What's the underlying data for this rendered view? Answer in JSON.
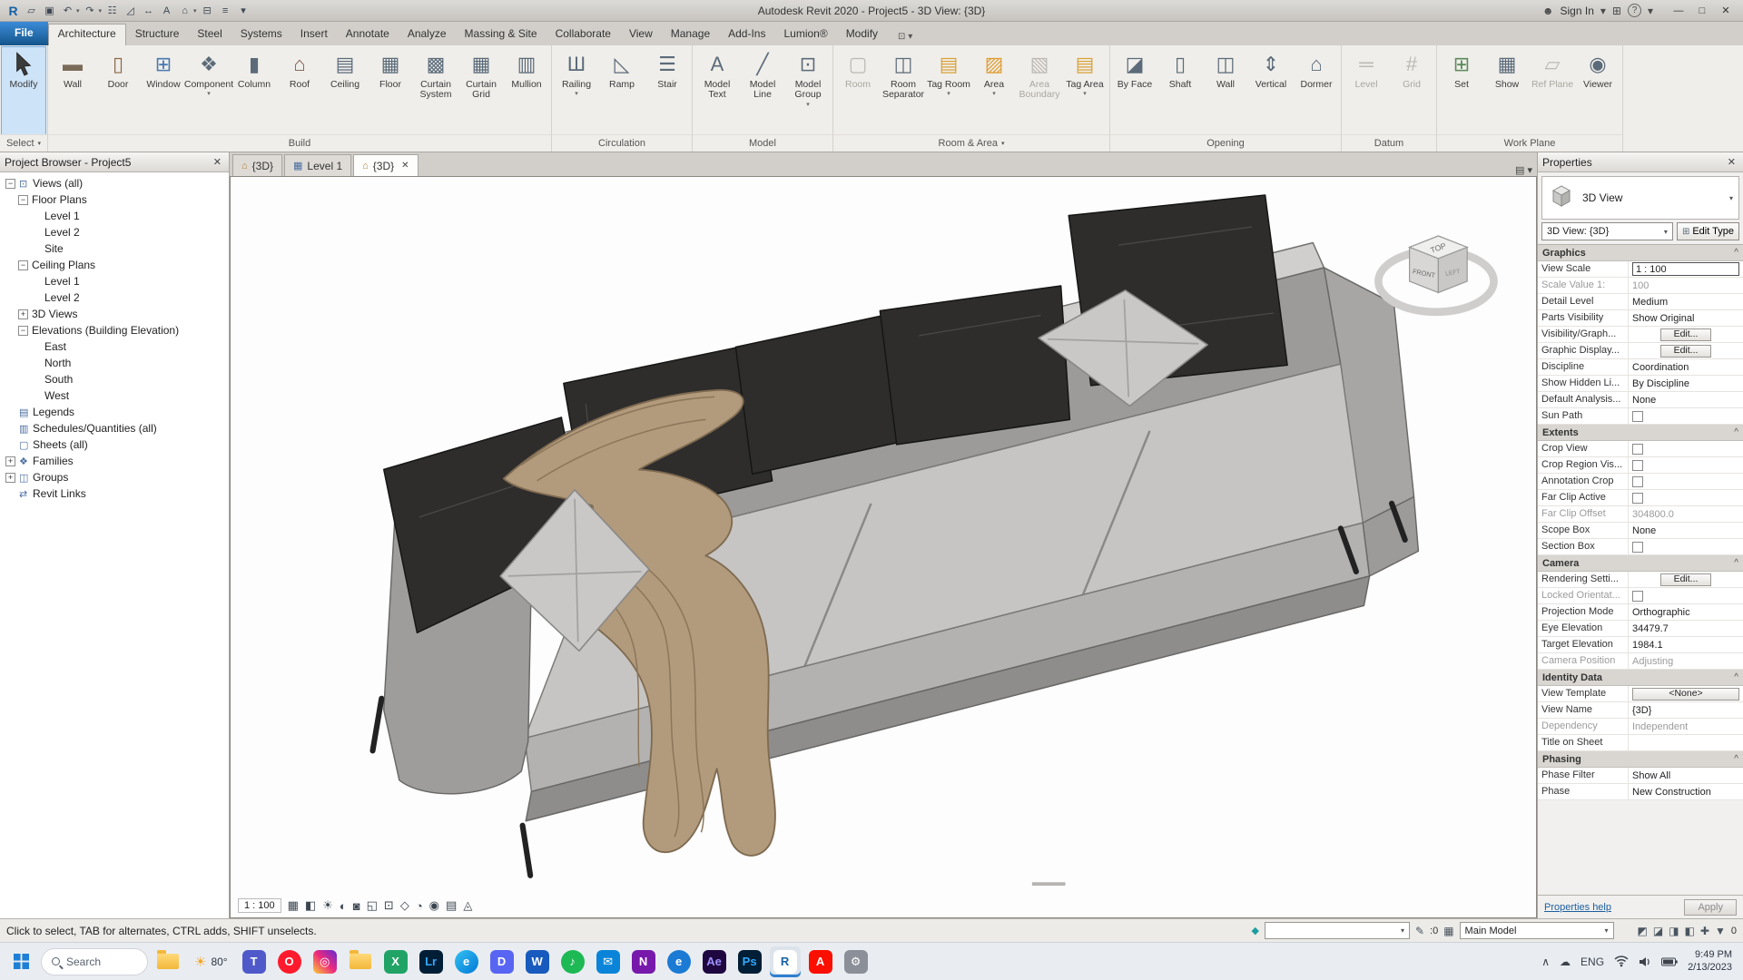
{
  "title_bar": {
    "title": "Autodesk Revit 2020 - Project5 - 3D View: {3D}",
    "qat": [
      {
        "name": "revit-logo",
        "glyph": "R"
      },
      {
        "name": "open-file",
        "glyph": "▱"
      },
      {
        "name": "save",
        "glyph": "▣"
      },
      {
        "name": "undo",
        "glyph": "↶",
        "dropdown": true
      },
      {
        "name": "redo",
        "glyph": "↷",
        "dropdown": true
      },
      {
        "name": "print",
        "glyph": "☷"
      },
      {
        "name": "measure",
        "glyph": "◿"
      },
      {
        "name": "aligned-dimension",
        "glyph": "↔"
      },
      {
        "name": "text-note",
        "glyph": "A"
      },
      {
        "name": "default-3d-view",
        "glyph": "⌂",
        "dropdown": true
      },
      {
        "name": "section",
        "glyph": "⊟"
      },
      {
        "name": "thin-lines",
        "glyph": "≡"
      },
      {
        "name": "customize-qat",
        "glyph": "▾"
      }
    ],
    "right": [
      {
        "name": "user-icon",
        "glyph": "☻"
      },
      {
        "name": "sign-in-label",
        "text": "Sign In"
      },
      {
        "name": "sign-in-caret",
        "glyph": "▾"
      },
      {
        "name": "app-store-icon",
        "glyph": "⊞"
      },
      {
        "name": "help-icon",
        "glyph": "?"
      },
      {
        "name": "help-caret",
        "glyph": "▾"
      }
    ],
    "window_controls": [
      {
        "name": "minimize-button",
        "glyph": "—"
      },
      {
        "name": "maximize-button",
        "glyph": "□"
      },
      {
        "name": "close-button",
        "glyph": "✕"
      }
    ]
  },
  "ribbon": {
    "tabs": [
      {
        "label": "File",
        "file": true
      },
      {
        "label": "Architecture",
        "active": true
      },
      {
        "label": "Structure"
      },
      {
        "label": "Steel"
      },
      {
        "label": "Systems"
      },
      {
        "label": "Insert"
      },
      {
        "label": "Annotate"
      },
      {
        "label": "Analyze"
      },
      {
        "label": "Massing & Site"
      },
      {
        "label": "Collaborate"
      },
      {
        "label": "View"
      },
      {
        "label": "Manage"
      },
      {
        "label": "Add-Ins"
      },
      {
        "label": "Lumion®"
      },
      {
        "label": "Modify"
      }
    ],
    "panels": [
      {
        "label": "Select",
        "dropdown": true,
        "buttons": [
          {
            "label": "Modify",
            "icon": "modify-cursor",
            "glyph": "",
            "big": true,
            "selected": true
          }
        ]
      },
      {
        "label": "Build",
        "buttons": [
          {
            "label": "Wall",
            "icon": "wall",
            "glyph": "▬",
            "color": "#7a6a58"
          },
          {
            "label": "Door",
            "icon": "door",
            "glyph": "▯",
            "color": "#8a6a4a"
          },
          {
            "label": "Window",
            "icon": "window",
            "glyph": "⊞",
            "color": "#4a78b0"
          },
          {
            "label": "Component",
            "icon": "component",
            "glyph": "❖",
            "dropdown": true
          },
          {
            "label": "Column",
            "icon": "column",
            "glyph": "▮"
          },
          {
            "label": "Roof",
            "icon": "roof",
            "glyph": "⌂",
            "color": "#7a5a48"
          },
          {
            "label": "Ceiling",
            "icon": "ceiling",
            "glyph": "▤"
          },
          {
            "label": "Floor",
            "icon": "floor",
            "glyph": "▦"
          },
          {
            "label": "Curtain System",
            "icon": "curtain-system",
            "glyph": "▩"
          },
          {
            "label": "Curtain Grid",
            "icon": "curtain-grid",
            "glyph": "▦"
          },
          {
            "label": "Mullion",
            "icon": "mullion",
            "glyph": "▥"
          }
        ]
      },
      {
        "label": "Circulation",
        "buttons": [
          {
            "label": "Railing",
            "icon": "railing",
            "glyph": "Ш",
            "dropdown": true
          },
          {
            "label": "Ramp",
            "icon": "ramp",
            "glyph": "◺"
          },
          {
            "label": "Stair",
            "icon": "stair",
            "glyph": "☰"
          }
        ]
      },
      {
        "label": "Model",
        "buttons": [
          {
            "label": "Model Text",
            "icon": "model-text",
            "glyph": "A"
          },
          {
            "label": "Model Line",
            "icon": "model-line",
            "glyph": "╱"
          },
          {
            "label": "Model Group",
            "icon": "model-group",
            "glyph": "⊡",
            "dropdown": true
          }
        ]
      },
      {
        "label": "Room & Area",
        "dropdown": true,
        "buttons": [
          {
            "label": "Room",
            "icon": "room",
            "glyph": "▢",
            "disabled": true
          },
          {
            "label": "Room Separator",
            "icon": "room-separator",
            "glyph": "◫"
          },
          {
            "label": "Tag Room",
            "icon": "tag-room",
            "glyph": "▤",
            "color": "#d9a23a",
            "dropdown": true
          },
          {
            "label": "Area",
            "icon": "area",
            "glyph": "▨",
            "color": "#de9b2e",
            "dropdown": true
          },
          {
            "label": "Area Boundary",
            "icon": "area-boundary",
            "glyph": "▧",
            "disabled": true
          },
          {
            "label": "Tag Area",
            "icon": "tag-area",
            "glyph": "▤",
            "color": "#d9a23a",
            "dropdown": true
          }
        ]
      },
      {
        "label": "Opening",
        "buttons": [
          {
            "label": "By Face",
            "icon": "opening-by-face",
            "glyph": "◪"
          },
          {
            "label": "Shaft",
            "icon": "shaft-opening",
            "glyph": "▯"
          },
          {
            "label": "Wall",
            "icon": "wall-opening",
            "glyph": "◫"
          },
          {
            "label": "Vertical",
            "icon": "vertical-opening",
            "glyph": "⇕"
          },
          {
            "label": "Dormer",
            "icon": "dormer-opening",
            "glyph": "⌂"
          }
        ]
      },
      {
        "label": "Datum",
        "buttons": [
          {
            "label": "Level",
            "icon": "level",
            "glyph": "═",
            "disabled": true
          },
          {
            "label": "Grid",
            "icon": "grid",
            "glyph": "#",
            "disabled": true
          }
        ]
      },
      {
        "label": "Work Plane",
        "buttons": [
          {
            "label": "Set",
            "icon": "set-work-plane",
            "glyph": "⊞",
            "color": "#5a8a5a"
          },
          {
            "label": "Show",
            "icon": "show-work-plane",
            "glyph": "▦"
          },
          {
            "label": "Ref Plane",
            "icon": "ref-plane",
            "glyph": "▱",
            "disabled": true
          },
          {
            "label": "Viewer",
            "icon": "viewer",
            "glyph": "◉"
          }
        ]
      }
    ]
  },
  "project_browser": {
    "title": "Project Browser - Project5",
    "items": [
      {
        "label": "Views (all)",
        "level": 0,
        "expander": "minus",
        "icon": "views"
      },
      {
        "label": "Floor Plans",
        "level": 1,
        "expander": "minus"
      },
      {
        "label": "Level 1",
        "level": 2
      },
      {
        "label": "Level 2",
        "level": 2
      },
      {
        "label": "Site",
        "level": 2
      },
      {
        "label": "Ceiling Plans",
        "level": 1,
        "expander": "minus"
      },
      {
        "label": "Level 1",
        "level": 2
      },
      {
        "label": "Level 2",
        "level": 2
      },
      {
        "label": "3D Views",
        "level": 1,
        "expander": "plus"
      },
      {
        "label": "Elevations (Building Elevation)",
        "level": 1,
        "expander": "minus"
      },
      {
        "label": "East",
        "level": 2
      },
      {
        "label": "North",
        "level": 2
      },
      {
        "label": "South",
        "level": 2
      },
      {
        "label": "West",
        "level": 2
      },
      {
        "label": "Legends",
        "level": 0,
        "icon": "legend"
      },
      {
        "label": "Schedules/Quantities (all)",
        "level": 0,
        "icon": "schedule"
      },
      {
        "label": "Sheets (all)",
        "level": 0,
        "icon": "sheet"
      },
      {
        "label": "Families",
        "level": 0,
        "expander": "plus",
        "icon": "family"
      },
      {
        "label": "Groups",
        "level": 0,
        "expander": "plus",
        "icon": "group"
      },
      {
        "label": "Revit Links",
        "level": 0,
        "icon": "link"
      }
    ]
  },
  "view_tabs": [
    {
      "label": "{3D}",
      "icon": "3d-view"
    },
    {
      "label": "Level 1",
      "icon": "plan-view"
    },
    {
      "label": "{3D}",
      "icon": "3d-view",
      "active": true,
      "closable": true
    }
  ],
  "viewport": {
    "scale": "1 : 100",
    "view_cube": {
      "top": "TOP",
      "front": "FRONT",
      "left": "LEFT"
    },
    "view_controls": [
      {
        "name": "detail-level-icon",
        "glyph": "▦"
      },
      {
        "name": "visual-style-icon",
        "glyph": "◧"
      },
      {
        "name": "sun-path-icon",
        "glyph": "☀"
      },
      {
        "name": "shadows-icon",
        "glyph": "◐"
      },
      {
        "name": "rendering-dialog-icon",
        "glyph": "◙"
      },
      {
        "name": "crop-view-icon",
        "glyph": "◱"
      },
      {
        "name": "show-crop-region-icon",
        "glyph": "⊡"
      },
      {
        "name": "unlocked-view-icon",
        "glyph": "◇"
      },
      {
        "name": "temporary-hide-isolate-icon",
        "glyph": "◔"
      },
      {
        "name": "reveal-hidden-elements-icon",
        "glyph": "◉"
      },
      {
        "name": "temporary-view-properties-icon",
        "glyph": "▤"
      },
      {
        "name": "show-constraints-icon",
        "glyph": "◬"
      }
    ]
  },
  "properties": {
    "title": "Properties",
    "type_name": "3D View",
    "selector": "3D View: {3D}",
    "edit_type": "Edit Type",
    "sections": [
      {
        "label": "Graphics",
        "rows": [
          {
            "label": "View Scale",
            "value": "1 : 100",
            "kind": "input-active"
          },
          {
            "label": "Scale Value   1:",
            "value": "100",
            "muted": true
          },
          {
            "label": "Detail Level",
            "value": "Medium"
          },
          {
            "label": "Parts Visibility",
            "value": "Show Original"
          },
          {
            "label": "Visibility/Graph...",
            "value": "Edit...",
            "kind": "button"
          },
          {
            "label": "Graphic Display...",
            "value": "Edit...",
            "kind": "button"
          },
          {
            "label": "Discipline",
            "value": "Coordination"
          },
          {
            "label": "Show Hidden Li...",
            "value": "By Discipline"
          },
          {
            "label": "Default Analysis...",
            "value": "None"
          },
          {
            "label": "Sun Path",
            "kind": "checkbox"
          }
        ]
      },
      {
        "label": "Extents",
        "rows": [
          {
            "label": "Crop View",
            "kind": "checkbox"
          },
          {
            "label": "Crop Region Vis...",
            "kind": "checkbox"
          },
          {
            "label": "Annotation Crop",
            "kind": "checkbox"
          },
          {
            "label": "Far Clip Active",
            "kind": "checkbox"
          },
          {
            "label": "Far Clip Offset",
            "value": "304800.0",
            "muted": true
          },
          {
            "label": "Scope Box",
            "value": "None"
          },
          {
            "label": "Section Box",
            "kind": "checkbox"
          }
        ]
      },
      {
        "label": "Camera",
        "rows": [
          {
            "label": "Rendering Setti...",
            "value": "Edit...",
            "kind": "button"
          },
          {
            "label": "Locked Orientat...",
            "kind": "checkbox",
            "muted": true
          },
          {
            "label": "Projection Mode",
            "value": "Orthographic"
          },
          {
            "label": "Eye Elevation",
            "value": "34479.7"
          },
          {
            "label": "Target Elevation",
            "value": "1984.1"
          },
          {
            "label": "Camera Position",
            "value": "Adjusting",
            "muted": true
          }
        ]
      },
      {
        "label": "Identity Data",
        "rows": [
          {
            "label": "View Template",
            "value": "<None>",
            "kind": "button-wide"
          },
          {
            "label": "View Name",
            "value": "{3D}"
          },
          {
            "label": "Dependency",
            "value": "Independent",
            "muted": true
          },
          {
            "label": "Title on Sheet",
            "value": ""
          }
        ]
      },
      {
        "label": "Phasing",
        "rows": [
          {
            "label": "Phase Filter",
            "value": "Show All"
          },
          {
            "label": "Phase",
            "value": "New Construction"
          }
        ]
      }
    ],
    "help_link": "Properties help",
    "apply_label": "Apply"
  },
  "status_bar": {
    "hint": "Click to select, TAB for alternates, CTRL adds, SHIFT unselects.",
    "editing_requests": ":0",
    "main_model_select": "Main Model",
    "selection_toggles": [
      "select-links-icon",
      "select-underlay-icon",
      "select-pinned-icon",
      "select-by-face-icon",
      "drag-on-selection-icon"
    ],
    "filter_count": "0"
  },
  "taskbar": {
    "search_placeholder": "Search",
    "weather": "80°",
    "icons": [
      {
        "name": "file-explorer-icon",
        "kind": "folder"
      },
      {
        "name": "weather-widget",
        "kind": "weather"
      },
      {
        "name": "teams-icon",
        "glyph": "T",
        "bg": "#5059c9"
      },
      {
        "name": "opera-icon",
        "glyph": "O",
        "bg": "#ff1b2d",
        "round": true
      },
      {
        "name": "instagram-icon",
        "glyph": "◎",
        "bg": "linear-gradient(45deg,#f9ce34,#ee2a7b,#6228d7)"
      },
      {
        "name": "folder-icon",
        "kind": "folder"
      },
      {
        "name": "excel-icon",
        "glyph": "X",
        "bg": "#21a366"
      },
      {
        "name": "lightroom-icon",
        "glyph": "Lr",
        "bg": "#001e36",
        "fg": "#31a8ff"
      },
      {
        "name": "edge-icon",
        "glyph": "e",
        "bg": "linear-gradient(135deg,#35c1f1,#0078d7)",
        "round": true
      },
      {
        "name": "discord-icon",
        "glyph": "D",
        "bg": "#5865f2"
      },
      {
        "name": "word-icon",
        "glyph": "W",
        "bg": "#185abd"
      },
      {
        "name": "spotify-icon",
        "glyph": "♪",
        "bg": "#1db954",
        "round": true
      },
      {
        "name": "mail-icon",
        "glyph": "✉",
        "bg": "#0a84d8"
      },
      {
        "name": "onenote-icon",
        "glyph": "N",
        "bg": "#7719aa"
      },
      {
        "name": "browser-icon",
        "glyph": "e",
        "bg": "#1b7bd4",
        "round": true
      },
      {
        "name": "after-effects-icon",
        "glyph": "Ae",
        "bg": "#1f0740",
        "fg": "#9f93ff"
      },
      {
        "name": "photoshop-icon",
        "glyph": "Ps",
        "bg": "#001e36",
        "fg": "#31a8ff"
      },
      {
        "name": "revit-icon",
        "glyph": "R",
        "bg": "#ffffff",
        "fg": "#1763a6",
        "active": true
      },
      {
        "name": "acrobat-icon",
        "glyph": "A",
        "bg": "#fa0f00"
      },
      {
        "name": "settings-icon",
        "glyph": "⚙",
        "bg": "#8a8f98"
      }
    ],
    "tray": {
      "items": [
        {
          "name": "hidden-icons-button",
          "glyph": "∧"
        },
        {
          "name": "onedrive-icon",
          "glyph": "☁"
        },
        {
          "name": "language-indicator",
          "text": "ENG"
        },
        {
          "name": "wifi-icon",
          "kind": "wifi"
        },
        {
          "name": "volume-icon",
          "kind": "volume"
        },
        {
          "name": "battery-icon",
          "kind": "battery"
        }
      ],
      "time": "9:49 PM",
      "date": "2/13/2023"
    }
  }
}
